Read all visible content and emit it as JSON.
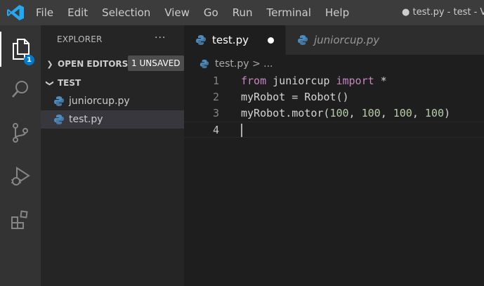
{
  "titlebar": {
    "menu": [
      "File",
      "Edit",
      "Selection",
      "View",
      "Go",
      "Run",
      "Terminal",
      "Help"
    ],
    "window_title": "● test.py - test - Vi"
  },
  "activity": {
    "explorer_badge": "1",
    "items": [
      "files-icon",
      "search-icon",
      "source-control-icon",
      "run-debug-icon",
      "extensions-icon"
    ]
  },
  "sidebar": {
    "header": "EXPLORER",
    "more": "···",
    "open_editors": {
      "title": "OPEN EDITORS",
      "badge": "1 UNSAVED"
    },
    "folder": {
      "title": "TEST"
    },
    "files": [
      "juniorcup.py",
      "test.py"
    ]
  },
  "tabs": [
    {
      "label": "test.py",
      "active": true,
      "dirty": true
    },
    {
      "label": "juniorcup.py",
      "active": false,
      "preview": true
    }
  ],
  "breadcrumb": {
    "file": "test.py",
    "sep": " > ",
    "more": "..."
  },
  "editor": {
    "line_numbers": [
      "1",
      "2",
      "3",
      "4"
    ],
    "line1": {
      "kw1": "from",
      "mid": " juniorcup ",
      "kw2": "import",
      "tail": " *"
    },
    "line2": {
      "text": "myRobot = Robot()"
    },
    "line3": {
      "head": "myRobot.motor(",
      "n1": "100",
      "c1": ", ",
      "n2": "100",
      "c2": ", ",
      "n3": "100",
      "c3": ", ",
      "n4": "100",
      "tail": ")"
    }
  },
  "colors": {
    "accent": "#007acc",
    "keyword": "#c586c0",
    "number": "#b5cea8",
    "python": "#4b8bbe"
  }
}
